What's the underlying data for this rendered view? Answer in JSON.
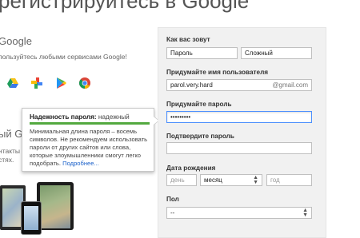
{
  "page": {
    "title": "регистрируйтесь в Google"
  },
  "left": {
    "heading1": "Google",
    "subtext1": "пользуйтесь любыми сервисами Google!",
    "apps": [
      "drive-icon",
      "photos-icon",
      "play-store-icon",
      "chrome-icon"
    ],
    "heading2": "ый G",
    "subtext2_line1": "нтакты",
    "subtext2_line2": "стях."
  },
  "tooltip": {
    "strength_label": "Надежность пароля:",
    "strength_value": "надежный",
    "strength_fraction": 1.0,
    "strength_color": "#53a93f",
    "text": "Минимальная длина пароля – восемь символов. Не рекомендуем использовать пароли от других сайтов или слова, которые злоумышленники смогут легко подобрать.",
    "link": "Подробнее..."
  },
  "form": {
    "name_label": "Как вас зовут",
    "first_name": "Пароль",
    "last_name": "Сложный",
    "username_label": "Придумайте имя пользователя",
    "username": "parol.very.hard",
    "username_suffix": "@gmail.com",
    "password_label": "Придумайте пароль",
    "password": "•••••••••",
    "confirm_label": "Подтвердите пароль",
    "confirm_value": "",
    "birthdate_label": "Дата рождения",
    "day_placeholder": "день",
    "month_value": "месяц",
    "year_placeholder": "год",
    "gender_label": "Пол",
    "gender_value": "--"
  }
}
